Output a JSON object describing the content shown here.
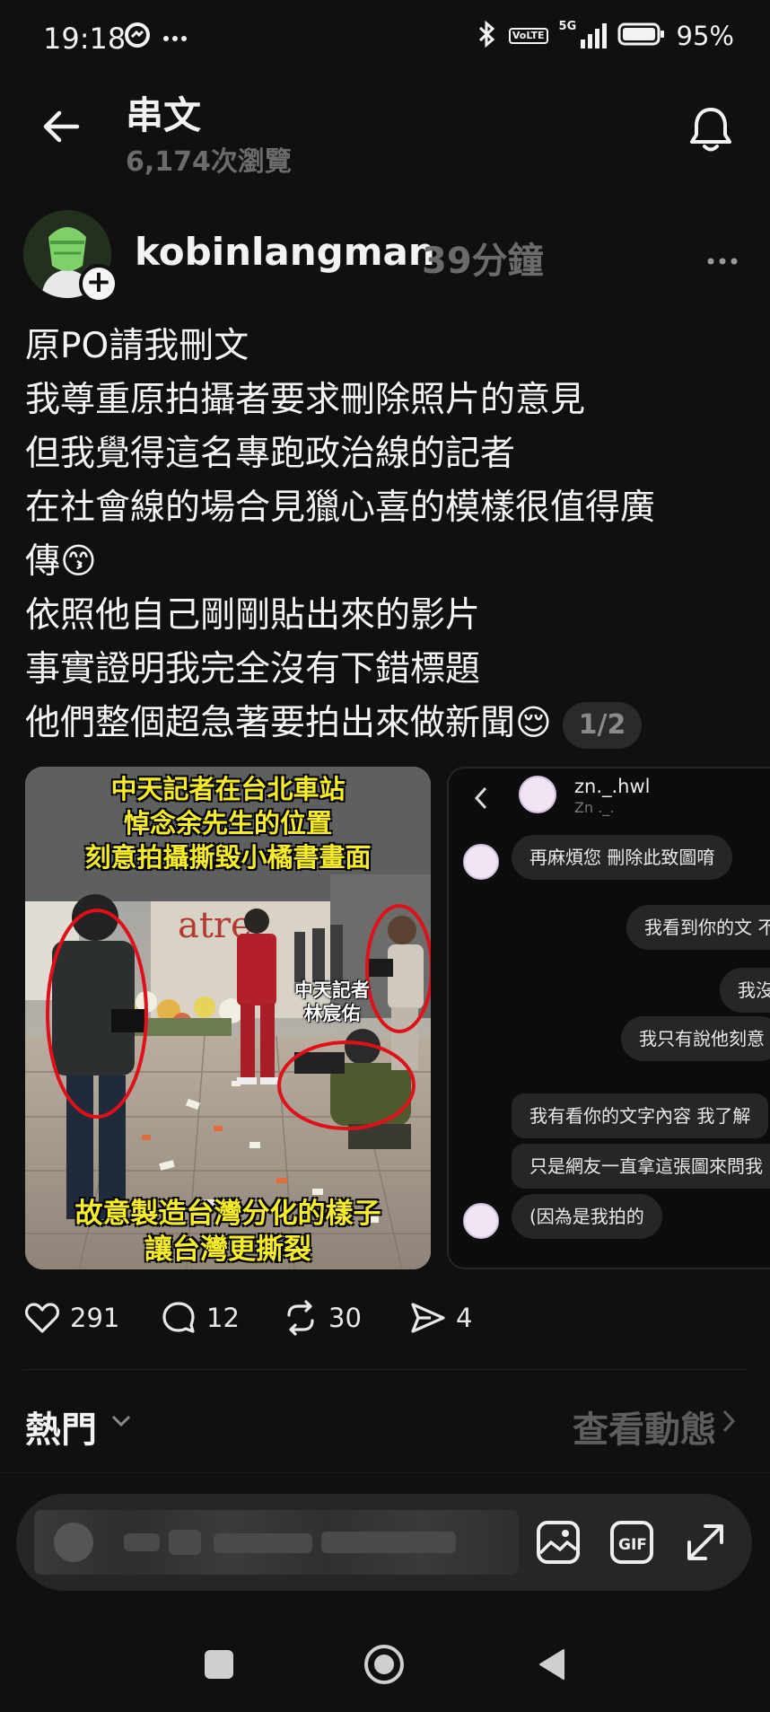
{
  "status_bar": {
    "time": "19:18",
    "battery": "95%",
    "network": "5G",
    "volte": "VoLTE",
    "icons": [
      "messenger-icon",
      "more-dots-icon",
      "bluetooth-icon",
      "volte-icon",
      "signal-icon",
      "battery-icon"
    ]
  },
  "header": {
    "title": "串文",
    "views": "6,174次瀏覽"
  },
  "post": {
    "username": "kobinlangman",
    "time": "39分鐘",
    "lines": [
      "原PO請我刪文",
      "我尊重原拍攝者要求刪除照片的意見",
      "但我覺得這名專跑政治線的記者",
      "在社會線的場合見獵心喜的模樣很值得廣",
      "傳😙",
      "依照他自己剛剛貼出來的影片",
      "事實證明我完全沒有下錯標題",
      "他們整個超急著要拍出來做新聞😌"
    ],
    "page_indicator": "1/2",
    "media1": {
      "caption_top": [
        "中天記者在台北車站",
        "悼念余先生的位置",
        "刻意拍攝撕毀小橘書畫面"
      ],
      "label_person": [
        "中天記者",
        "林宸佑"
      ],
      "caption_bottom": [
        "故意製造台灣分化的樣子",
        "讓台灣更撕裂"
      ],
      "sign_text": "atre"
    },
    "media2": {
      "name": "zn._.hwl",
      "handle": "Zn ._.",
      "messages": [
        "再麻煩您  刪除此致圖唷",
        "我看到你的文 不",
        "我沒",
        "我只有說他刻意",
        "我有看你的文字內容  我了解",
        "只是網友一直拿這張圖來問我",
        "(因為是我拍的"
      ]
    },
    "stats": {
      "likes": "291",
      "comments": "12",
      "reposts": "30",
      "shares": "4"
    }
  },
  "feed": {
    "hot_label": "熱門",
    "view_activity": "查看動態"
  },
  "colors": {
    "background": "#101010",
    "muted": "#6b6b6b",
    "caption_yellow": "#f6ec2a",
    "circle_red": "#e0101a"
  }
}
